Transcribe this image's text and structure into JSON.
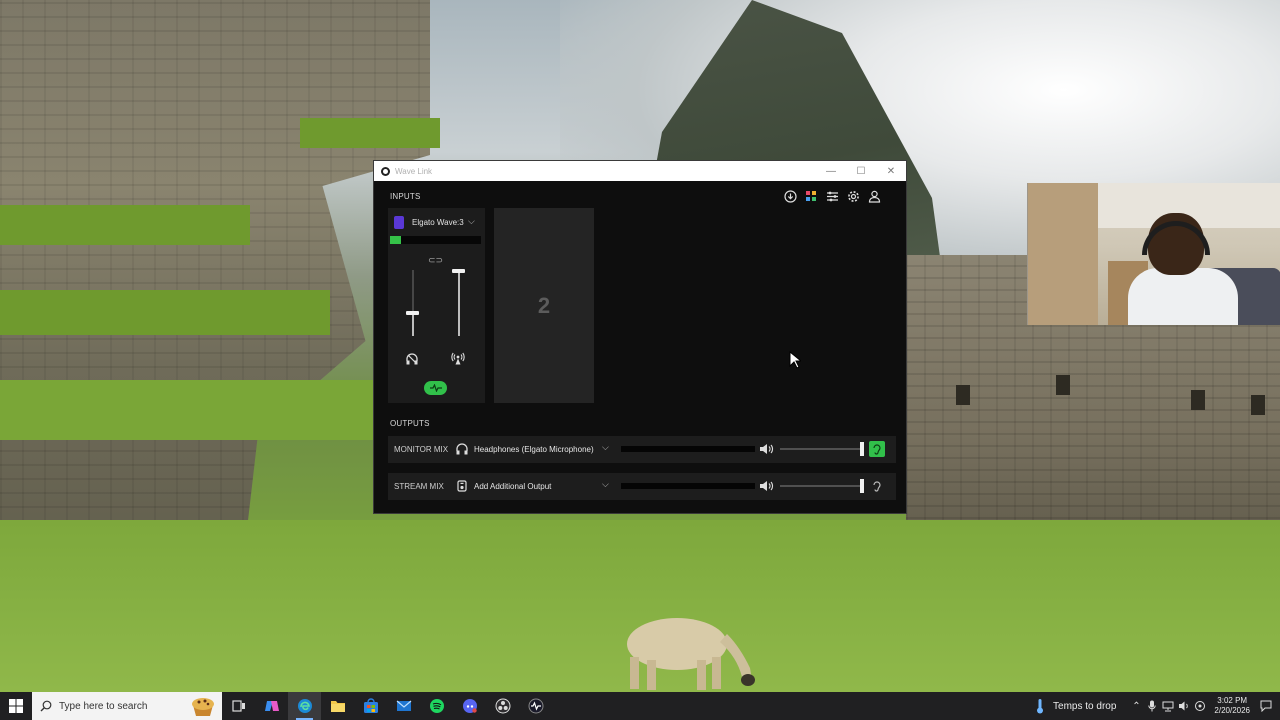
{
  "window": {
    "title": "Wave Link",
    "controls": {
      "minimize": "—",
      "maximize": "☐",
      "close": "✕"
    }
  },
  "inputs": {
    "section_label": "INPUTS",
    "device": {
      "name": "Elgato Wave:3",
      "level": 0.12,
      "monitor_fader": 0.35,
      "stream_fader": 0.98
    },
    "empty_slot_number": "2"
  },
  "toolbar_icons": [
    "download-icon",
    "apps-icon",
    "mixer-icon",
    "settings-gear-icon",
    "account-icon"
  ],
  "outputs": {
    "section_label": "OUTPUTS",
    "rows": [
      {
        "mix": "MONITOR MIX",
        "device": "Headphones (Elgato Microphone)",
        "device_icon": "headphones-icon",
        "volume": 1.0,
        "listen_active": true
      },
      {
        "mix": "STREAM MIX",
        "device": "Add Additional Output",
        "device_icon": "device-icon",
        "volume": 1.0,
        "listen_active": false
      }
    ]
  },
  "taskbar": {
    "search_placeholder": "Type here to search",
    "apps": [
      "task-view-icon",
      "copilot-icon",
      "edge-icon",
      "file-explorer-icon",
      "microsoft-store-icon",
      "mail-icon",
      "spotify-icon",
      "discord-icon",
      "obs-icon",
      "wave-link-icon"
    ],
    "weather_text": "Temps to drop",
    "time": "3:02 PM",
    "date": "2/20/2026"
  },
  "colors": {
    "accent_green": "#31c04a",
    "wave_purple": "#5a38d6",
    "taskbar": "#202022"
  }
}
